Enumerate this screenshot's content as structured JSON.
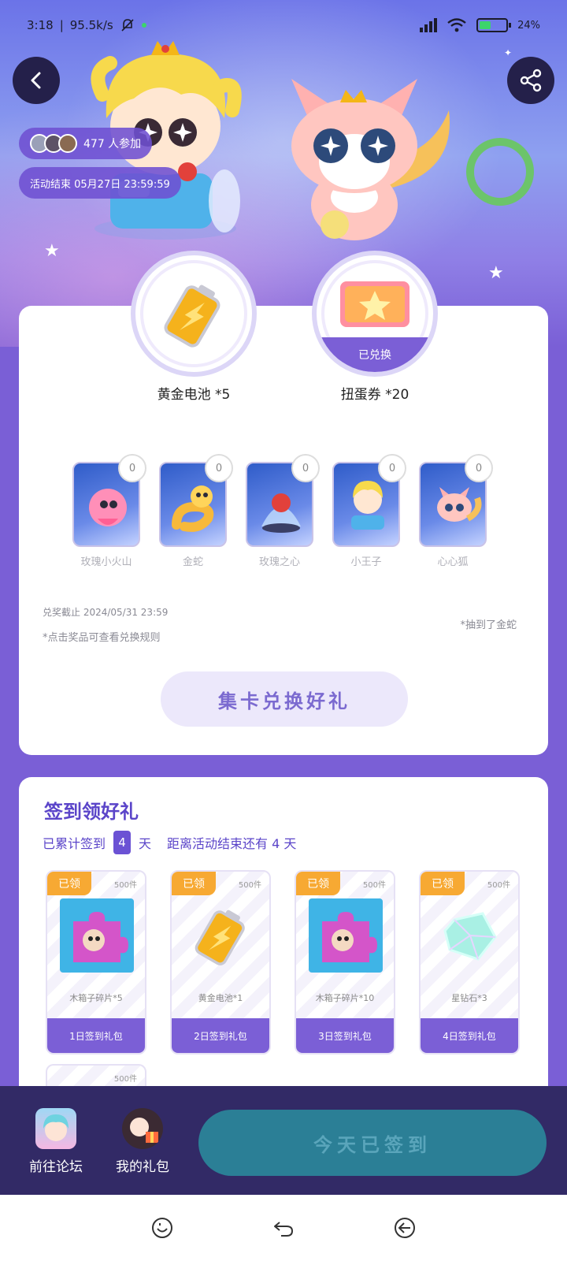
{
  "status_bar": {
    "time": "3:18",
    "speed": "95.5k/s",
    "battery": "24",
    "battery_unit": "%"
  },
  "header": {
    "participants": "477 人参加",
    "end_time": "活动结束 05月27日 23:59:59"
  },
  "prizes": [
    {
      "label": "黄金电池 *5",
      "redeemed": false
    },
    {
      "label": "扭蛋券 *20",
      "redeemed": true,
      "redeemed_label": "已兑换"
    }
  ],
  "collect_cards": [
    {
      "name": "玫瑰小火山",
      "count": "0"
    },
    {
      "name": "金蛇",
      "count": "0"
    },
    {
      "name": "玫瑰之心",
      "count": "0"
    },
    {
      "name": "小王子",
      "count": "0"
    },
    {
      "name": "心心狐",
      "count": "0"
    }
  ],
  "exchange": {
    "deadline": "兑奖截止 2024/05/31 23:59",
    "rule_hint": "*点击奖品可查看兑换规则",
    "got_note": "*抽到了金蛇",
    "button": "集卡兑换好礼"
  },
  "sign_in": {
    "title": "签到领好礼",
    "progress_prefix": "已累计签到",
    "days": "4",
    "progress_suffix": "天",
    "remaining": "距离活动结束还有 4 天",
    "gifts": [
      {
        "tag": "已领",
        "qty": "500件",
        "name": "木箱子碎片*5",
        "button": "1日签到礼包"
      },
      {
        "tag": "已领",
        "qty": "500件",
        "name": "黄金电池*1",
        "button": "2日签到礼包"
      },
      {
        "tag": "已领",
        "qty": "500件",
        "name": "木箱子碎片*10",
        "button": "3日签到礼包"
      },
      {
        "tag": "已领",
        "qty": "500件",
        "name": "星钻石*3",
        "button": "4日签到礼包"
      }
    ],
    "next_gift_qty": "500件"
  },
  "bottom_bar": {
    "forum": "前往论坛",
    "my_gifts": "我的礼包",
    "signed_button": "今天已签到"
  },
  "colors": {
    "accent": "#7b5fd6",
    "claimed_tag": "#f7a933",
    "bottom_bar": "#322a66",
    "signed_button": "#2b7f96"
  }
}
